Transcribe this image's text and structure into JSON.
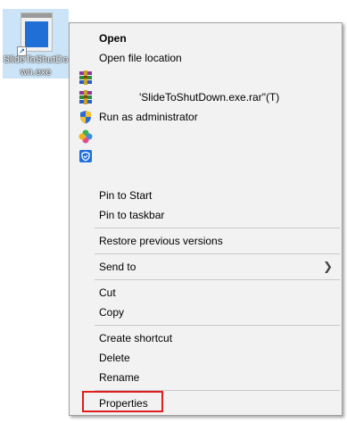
{
  "desktop_icon": {
    "label": "SlideToShutDown.exe"
  },
  "menu": {
    "open": "Open",
    "open_file_location": "Open file location",
    "winrar_extract": "",
    "winrar_add": "'SlideToShutDown.exe.rar\"(T)",
    "run_as_admin": "Run as administrator",
    "pin_to_start": "Pin to Start",
    "pin_to_taskbar": "Pin to taskbar",
    "restore_previous_versions": "Restore previous versions",
    "send_to": "Send to",
    "send_to_arrow": "❯",
    "cut": "Cut",
    "copy": "Copy",
    "create_shortcut": "Create shortcut",
    "delete": "Delete",
    "rename": "Rename",
    "properties": "Properties"
  },
  "colors": {
    "selection_bg": "#cce4f7",
    "highlight_border": "#e01e1e",
    "menu_bg": "#f2f2f2"
  }
}
